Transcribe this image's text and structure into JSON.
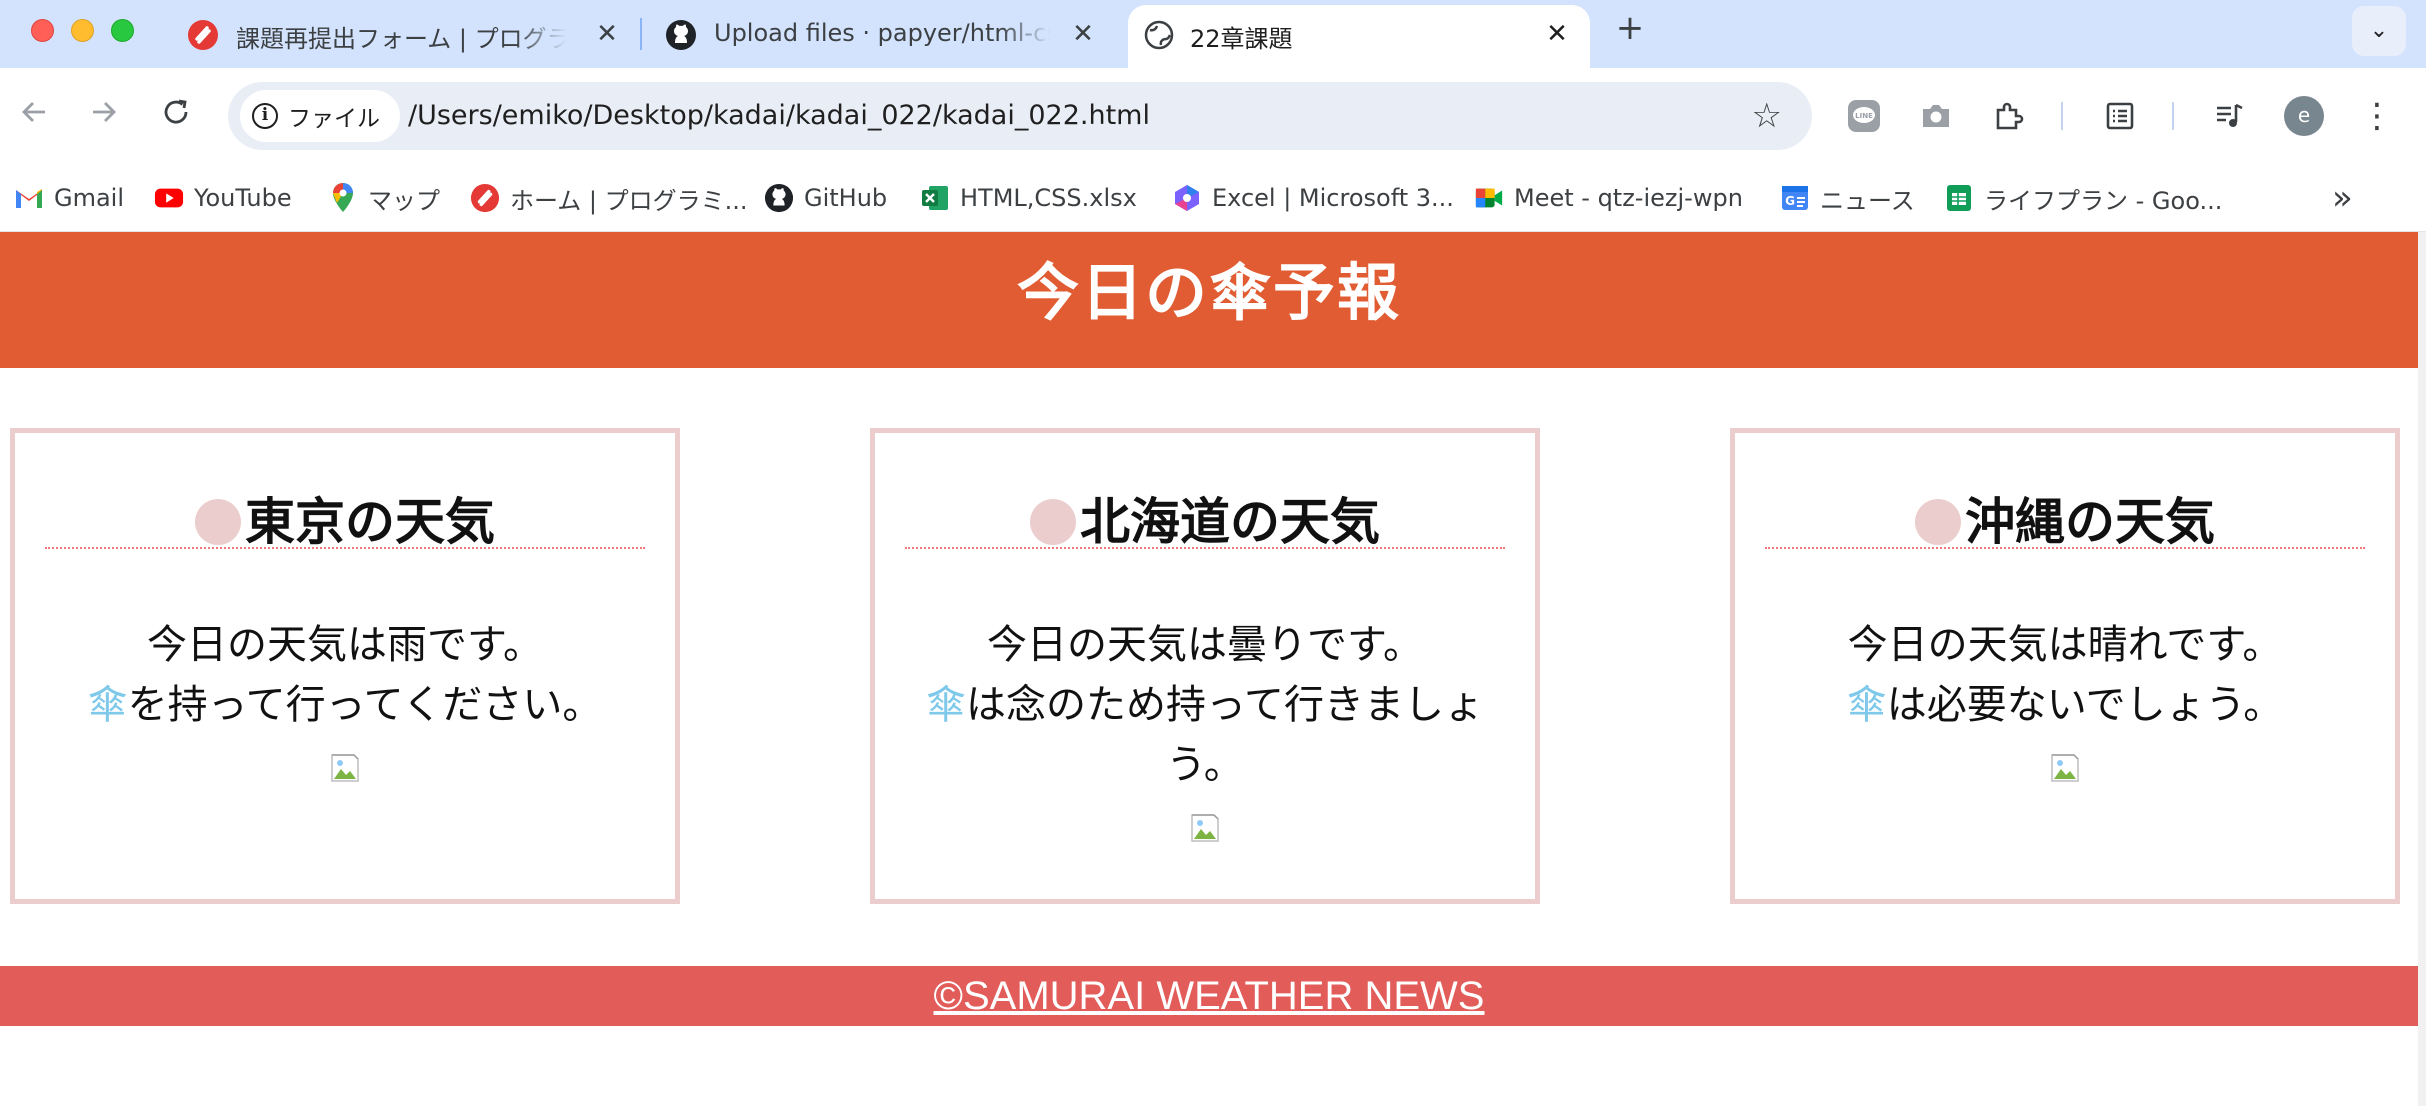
{
  "browser": {
    "tabs": [
      {
        "title": "課題再提出フォーム | プログラミ",
        "favicon": "samurai-icon",
        "active": false
      },
      {
        "title": "Upload files · papyer/html-css",
        "favicon": "github-icon",
        "active": false
      },
      {
        "title": "22章課題",
        "favicon": "globe-icon",
        "active": true
      }
    ],
    "new_tab_label": "+",
    "omnibox": {
      "chip_label": "ファイル",
      "url": "/Users/emiko/Desktop/kadai/kadai_022/kadai_022.html"
    },
    "avatar_letter": "e",
    "bookmarks": [
      {
        "label": "Gmail",
        "icon": "gmail-icon"
      },
      {
        "label": "YouTube",
        "icon": "youtube-icon"
      },
      {
        "label": "マップ",
        "icon": "maps-icon"
      },
      {
        "label": "ホーム | プログラミ...",
        "icon": "samurai-icon"
      },
      {
        "label": "GitHub",
        "icon": "github-icon"
      },
      {
        "label": "HTML,CSS.xlsx",
        "icon": "excel-icon"
      },
      {
        "label": "Excel | Microsoft 3...",
        "icon": "microsoft365-icon"
      },
      {
        "label": "Meet - qtz-iezj-wpn",
        "icon": "meet-icon"
      },
      {
        "label": "ニュース",
        "icon": "news-icon"
      },
      {
        "label": "ライフプラン - Goo...",
        "icon": "sheets-icon"
      }
    ]
  },
  "page": {
    "title": "今日の傘予報",
    "cards": [
      {
        "title": "東京の天気",
        "line1": "今日の天気は雨です。",
        "umbrella": "傘",
        "line2": "を持って行ってください。"
      },
      {
        "title": "北海道の天気",
        "line1": "今日の天気は曇りです。",
        "umbrella": "傘",
        "line2": "は念のため持って行きましょう。"
      },
      {
        "title": "沖縄の天気",
        "line1": "今日の天気は晴れです。",
        "umbrella": "傘",
        "line2": "は必要ないでしょう。"
      }
    ],
    "footer": "©SAMURAI WEATHER NEWS"
  },
  "colors": {
    "header_bg": "#e15c32",
    "card_border": "#ebcdcd",
    "dotted_rule": "#f07a7a",
    "umbrella_text": "#7ec8ea",
    "footer_bg": "#e25c5a",
    "tabstrip_bg": "#d3e3fd"
  }
}
